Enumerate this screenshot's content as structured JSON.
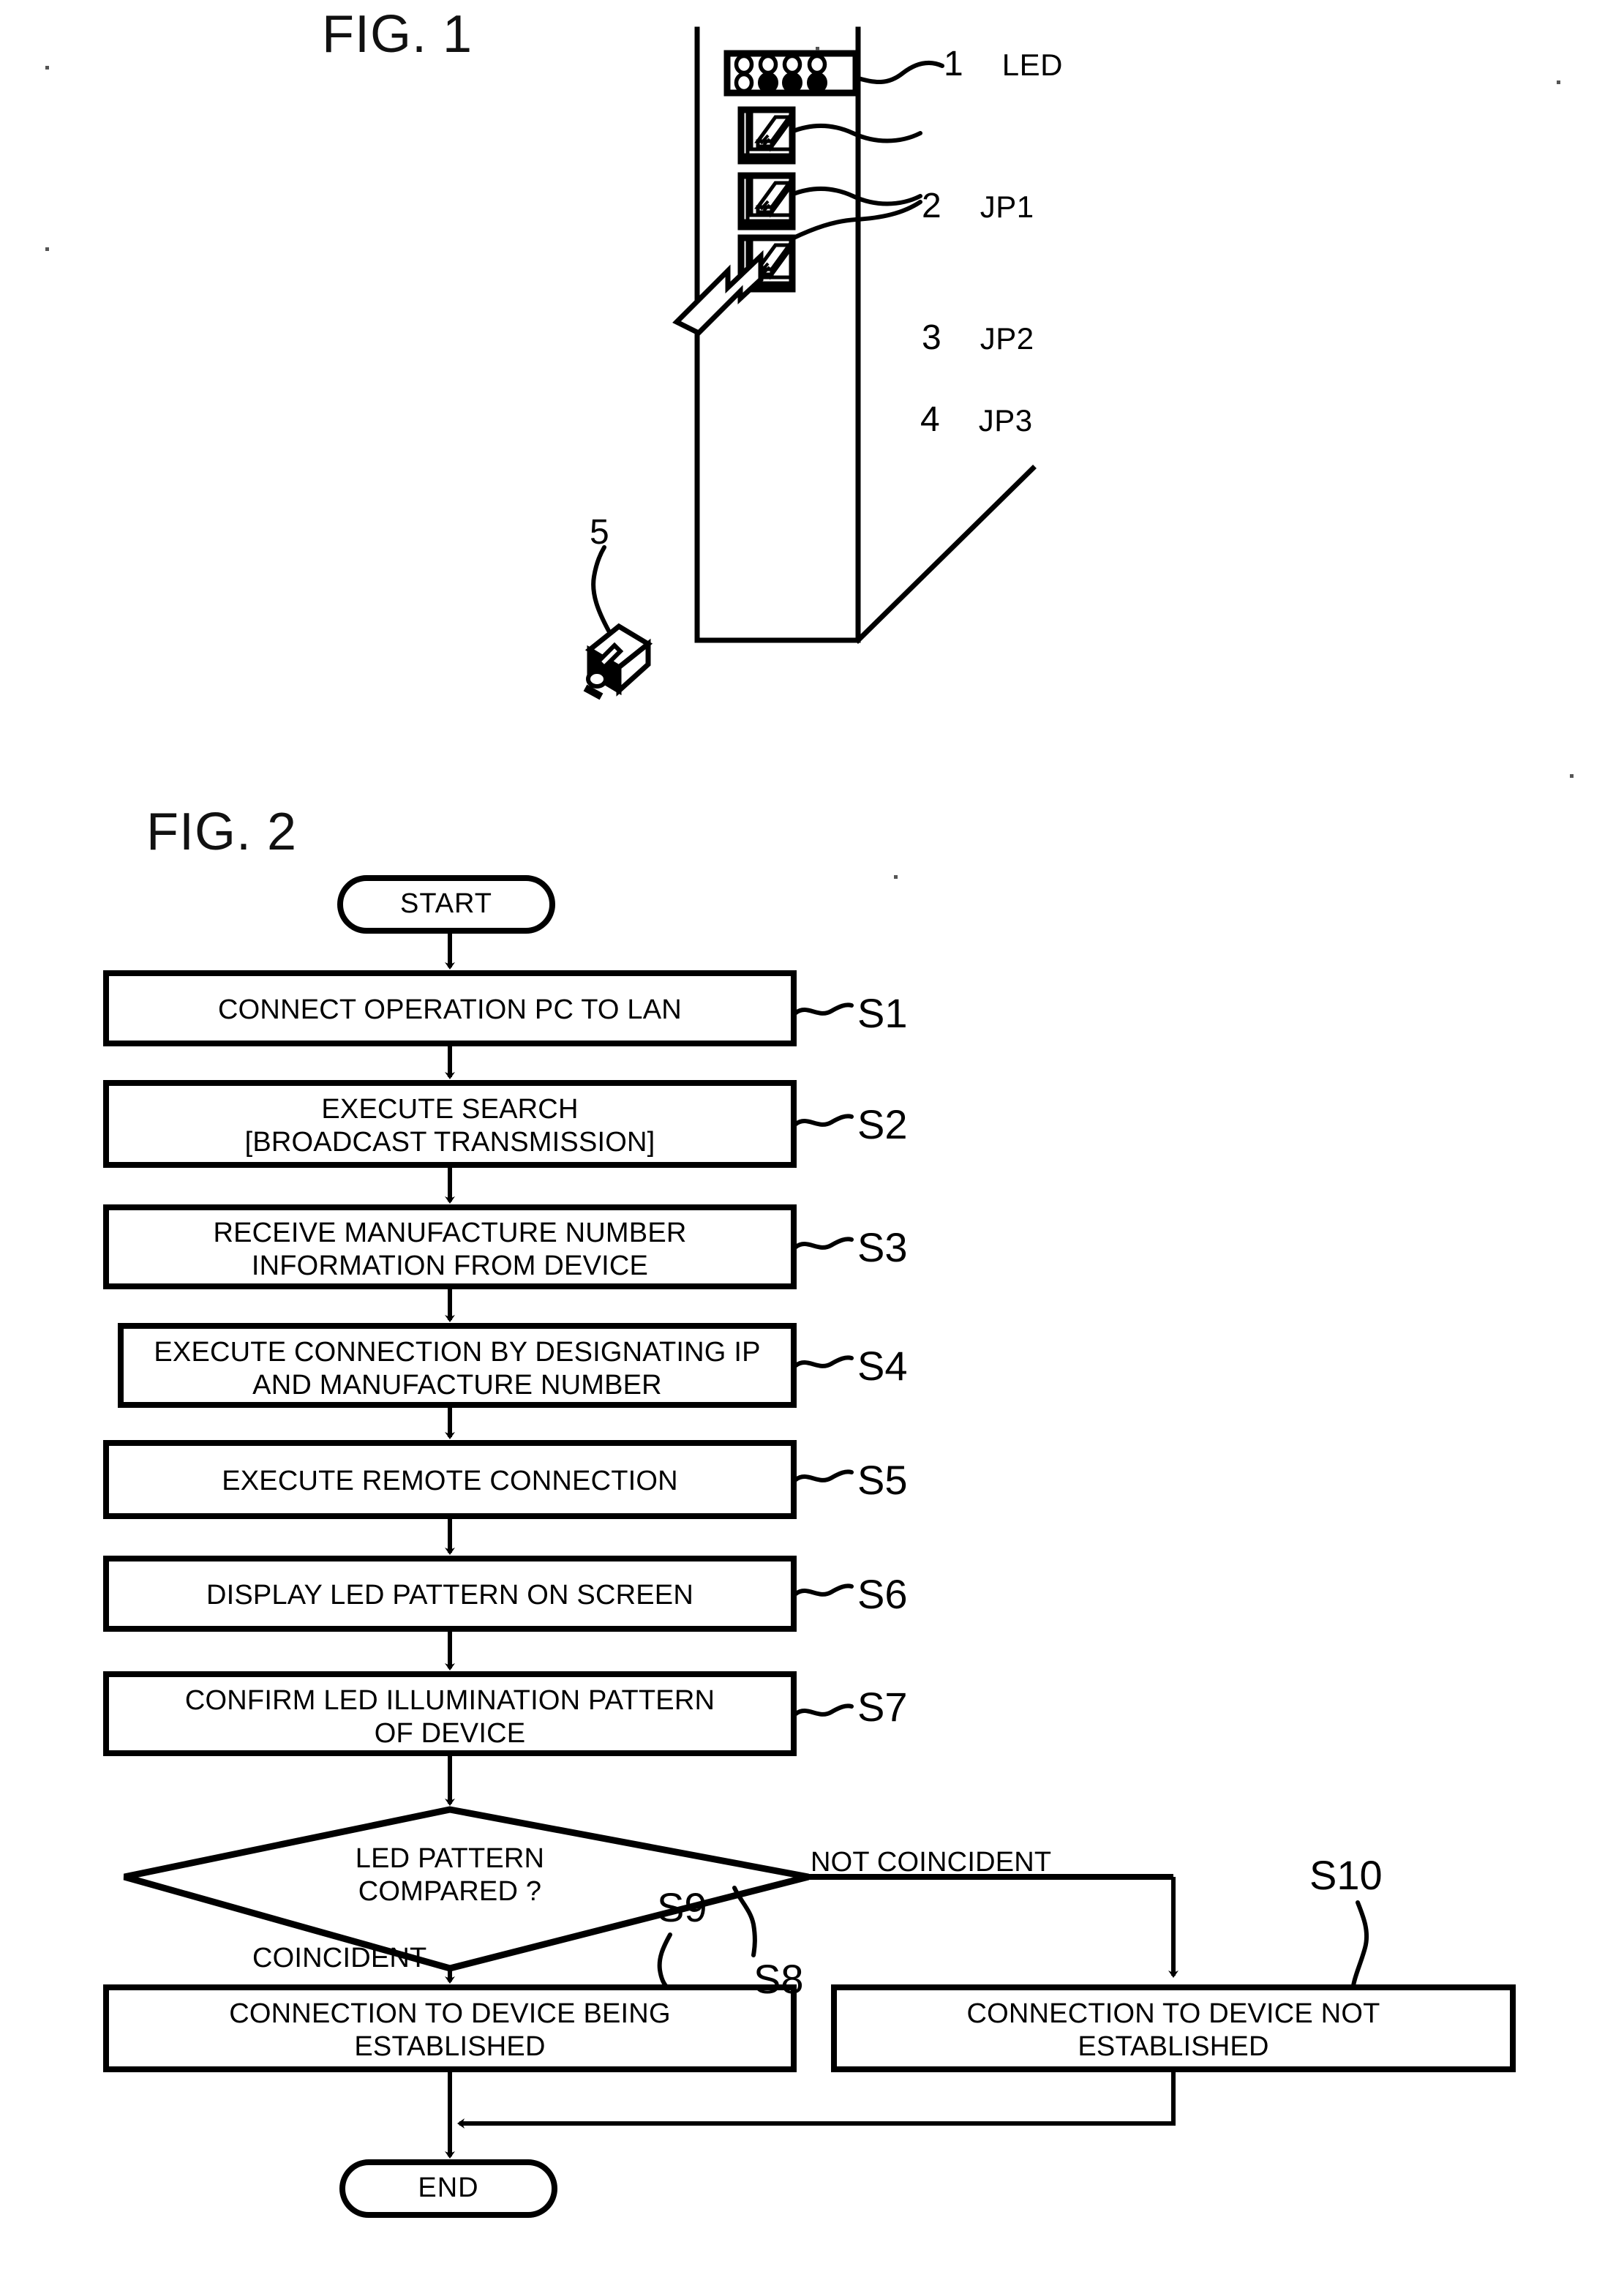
{
  "figures": [
    {
      "id": "fig1",
      "title": "FIG. 1",
      "type": "device-panel-illustration",
      "callouts": [
        {
          "num": "1",
          "name": "LED"
        },
        {
          "num": "2",
          "name": "JP1"
        },
        {
          "num": "3",
          "name": "JP2"
        },
        {
          "num": "4",
          "name": "JP3"
        },
        {
          "num": "5",
          "name": ""
        }
      ],
      "led_panel": {
        "rows": [
          [
            "off",
            "off",
            "off",
            "off"
          ],
          [
            "off",
            "on",
            "on",
            "on"
          ]
        ]
      },
      "jumper_sockets": [
        "JP1",
        "JP2",
        "JP3"
      ]
    },
    {
      "id": "fig2",
      "title": "FIG. 2",
      "type": "flowchart",
      "terminators": {
        "start": "START",
        "end": "END"
      },
      "steps": [
        {
          "tag": "S1",
          "text": "CONNECT OPERATION PC TO LAN"
        },
        {
          "tag": "S2",
          "text": "EXECUTE SEARCH\n[BROADCAST TRANSMISSION]"
        },
        {
          "tag": "S3",
          "text": "RECEIVE MANUFACTURE NUMBER\nINFORMATION FROM DEVICE"
        },
        {
          "tag": "S4",
          "text": "EXECUTE CONNECTION BY DESIGNATING IP\nAND MANUFACTURE NUMBER"
        },
        {
          "tag": "S5",
          "text": "EXECUTE REMOTE CONNECTION"
        },
        {
          "tag": "S6",
          "text": "DISPLAY LED PATTERN ON SCREEN"
        },
        {
          "tag": "S7",
          "text": "CONFIRM LED ILLUMINATION PATTERN\nOF DEVICE"
        }
      ],
      "decision": {
        "tag": "S8",
        "text": "LED PATTERN\nCOMPARED ?"
      },
      "branches": {
        "yes_label": "COINCIDENT",
        "no_label": "NOT COINCIDENT"
      },
      "outcomes": [
        {
          "tag": "S9",
          "text": "CONNECTION TO DEVICE BEING\nESTABLISHED"
        },
        {
          "tag": "S10",
          "text": "CONNECTION TO DEVICE NOT\nESTABLISHED"
        }
      ]
    }
  ],
  "colors": {
    "ink": "#000000",
    "paper": "#ffffff"
  }
}
